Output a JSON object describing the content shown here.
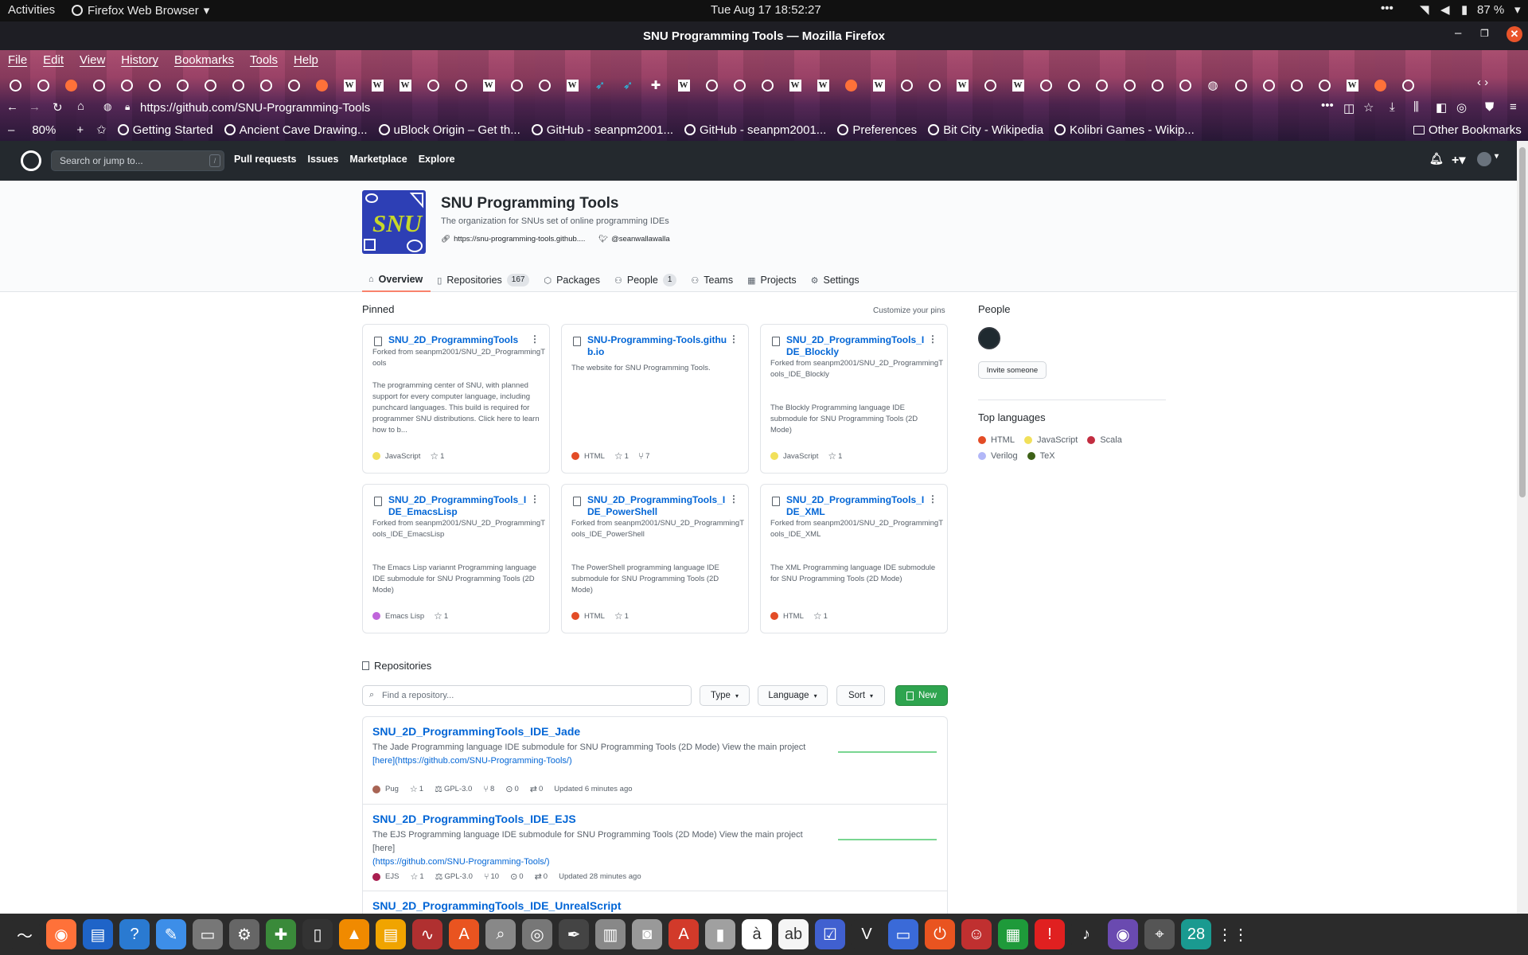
{
  "topbar": {
    "activities": "Activities",
    "app_name": "Firefox Web Browser",
    "datetime": "Tue Aug 17  18:52:27",
    "battery": "87 %"
  },
  "window": {
    "title": "SNU Programming Tools — Mozilla Firefox"
  },
  "menu": [
    "File",
    "Edit",
    "View",
    "History",
    "Bookmarks",
    "Tools",
    "Help"
  ],
  "tab_icons": [
    "gh",
    "gh",
    "ff",
    "gh",
    "gh",
    "gh",
    "gh",
    "gh",
    "gh",
    "gh",
    "gh",
    "ff",
    "w",
    "w",
    "w",
    "gh",
    "gh",
    "w",
    "gh",
    "gh",
    "w",
    "bird",
    "bird",
    "puzzle",
    "w",
    "gh",
    "gh",
    "gh",
    "w",
    "w",
    "ff",
    "w",
    "gh",
    "gh",
    "w",
    "gh",
    "w",
    "gh",
    "gh",
    "gh",
    "gh",
    "gh",
    "gh",
    "globe",
    "gh",
    "gh",
    "gh",
    "gh",
    "w",
    "ff",
    "gh"
  ],
  "nav": {
    "url": "https://github.com/SNU-Programming-Tools",
    "zoom": "80%"
  },
  "bookmarks": [
    "Getting Started",
    "Ancient Cave Drawing...",
    "uBlock Origin – Get th...",
    "GitHub - seanpm2001...",
    "GitHub - seanpm2001...",
    "Preferences",
    "Bit City - Wikipedia",
    "Kolibri Games - Wikip..."
  ],
  "other_bookmarks": "Other Bookmarks",
  "gh": {
    "search_placeholder": "Search or jump to...",
    "search_key": "/",
    "nav": [
      "Pull requests",
      "Issues",
      "Marketplace",
      "Explore"
    ]
  },
  "org": {
    "logo_text": "SNU",
    "name": "SNU Programming Tools",
    "description": "The organization for SNUs set of online programming IDEs",
    "website": "https://snu-programming-tools.github....",
    "twitter": "@seanwallawalla",
    "tabs": [
      {
        "label": "Overview",
        "count": ""
      },
      {
        "label": "Repositories",
        "count": "167"
      },
      {
        "label": "Packages",
        "count": ""
      },
      {
        "label": "People",
        "count": "1"
      },
      {
        "label": "Teams",
        "count": ""
      },
      {
        "label": "Projects",
        "count": ""
      },
      {
        "label": "Settings",
        "count": ""
      }
    ]
  },
  "pinned": {
    "heading": "Pinned",
    "customize": "Customize your pins",
    "cards": [
      {
        "title": "SNU_2D_ProgrammingTools",
        "fork": "Forked from seanpm2001/SNU_2D_ProgrammingTools",
        "desc": "The programming center of SNU, with planned support for every computer language, including punchcard languages. This build is required for programmer SNU distributions. Click here to learn how to b...",
        "lang": "JavaScript",
        "color": "#f1e05a",
        "stars": "1",
        "forks": ""
      },
      {
        "title": "SNU-Programming-Tools.github.io",
        "fork": "",
        "desc": "The website for SNU Programming Tools.",
        "lang": "HTML",
        "color": "#e34c26",
        "stars": "1",
        "forks": "7"
      },
      {
        "title": "SNU_2D_ProgrammingTools_IDE_Blockly",
        "fork": "Forked from seanpm2001/SNU_2D_ProgrammingTools_IDE_Blockly",
        "desc": "The Blockly Programming language IDE submodule for SNU Programming Tools (2D Mode)",
        "lang": "JavaScript",
        "color": "#f1e05a",
        "stars": "1",
        "forks": ""
      },
      {
        "title": "SNU_2D_ProgrammingTools_IDE_EmacsLisp",
        "fork": "Forked from seanpm2001/SNU_2D_ProgrammingTools_IDE_EmacsLisp",
        "desc": "The Emacs Lisp variannt Programming language IDE submodule for SNU Programming Tools (2D Mode)",
        "lang": "Emacs Lisp",
        "color": "#c065db",
        "stars": "1",
        "forks": ""
      },
      {
        "title": "SNU_2D_ProgrammingTools_IDE_PowerShell",
        "fork": "Forked from seanpm2001/SNU_2D_ProgrammingTools_IDE_PowerShell",
        "desc": "The PowerShell programming language IDE submodule for SNU Programming Tools (2D Mode)",
        "lang": "HTML",
        "color": "#e34c26",
        "stars": "1",
        "forks": ""
      },
      {
        "title": "SNU_2D_ProgrammingTools_IDE_XML",
        "fork": "Forked from seanpm2001/SNU_2D_ProgrammingTools_IDE_XML",
        "desc": "The XML Programming language IDE submodule for SNU Programming Tools (2D Mode)",
        "lang": "HTML",
        "color": "#e34c26",
        "stars": "1",
        "forks": ""
      }
    ]
  },
  "people": {
    "heading": "People",
    "invite": "Invite someone"
  },
  "top_languages": {
    "heading": "Top languages",
    "items": [
      {
        "name": "HTML",
        "color": "#e34c26"
      },
      {
        "name": "JavaScript",
        "color": "#f1e05a"
      },
      {
        "name": "Scala",
        "color": "#c22d40"
      },
      {
        "name": "Verilog",
        "color": "#b2b7f8"
      },
      {
        "name": "TeX",
        "color": "#3d6117"
      }
    ]
  },
  "repositories": {
    "heading": "Repositories",
    "find_placeholder": "Find a repository...",
    "type_label": "Type",
    "language_label": "Language",
    "sort_label": "Sort",
    "new_label": "New",
    "items": [
      {
        "name": "SNU_2D_ProgrammingTools_IDE_Jade",
        "desc1": "The Jade Programming language IDE submodule for SNU Programming Tools (2D Mode) View the main project",
        "desc2": "[here](https://github.com/SNU-Programming-Tools/)",
        "lang": "Pug",
        "color": "#a86454",
        "stars": "1",
        "license": "GPL-3.0",
        "forks": "8",
        "issues": "0",
        "prs": "0",
        "updated": "Updated 6 minutes ago"
      },
      {
        "name": "SNU_2D_ProgrammingTools_IDE_EJS",
        "desc1": "The EJS Programming language IDE submodule for SNU Programming Tools (2D Mode) View the main project [here]",
        "desc2": "(https://github.com/SNU-Programming-Tools/)",
        "lang": "EJS",
        "color": "#a91e50",
        "stars": "1",
        "license": "GPL-3.0",
        "forks": "10",
        "issues": "0",
        "prs": "0",
        "updated": "Updated 28 minutes ago"
      },
      {
        "name": "SNU_2D_ProgrammingTools_IDE_UnrealScript",
        "desc1": "",
        "desc2": "",
        "lang": "",
        "color": "",
        "stars": "",
        "license": "",
        "forks": "",
        "issues": "",
        "prs": "",
        "updated": ""
      }
    ]
  },
  "dock_icons": [
    "monitor",
    "firefox",
    "document",
    "help",
    "editor",
    "files",
    "settings",
    "puzzle",
    "terminal",
    "vlc",
    "calc",
    "chart",
    "store",
    "viewer",
    "disc",
    "inkscape",
    "image",
    "reader",
    "pdf",
    "archive",
    "text",
    "font",
    "tasks",
    "vim",
    "screen",
    "ubuntu",
    "mario",
    "sheet",
    "alert",
    "music",
    "capture",
    "system",
    "calendar",
    "apps"
  ],
  "dock_date": "28"
}
